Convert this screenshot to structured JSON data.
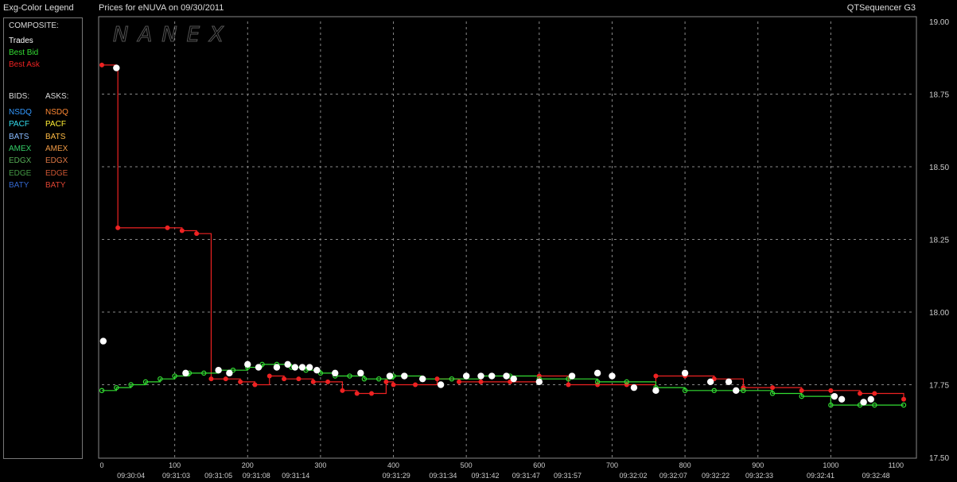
{
  "header": {
    "legend_title": "Exg-Color Legend",
    "chart_title": "Prices for  eNUVA  on  09/30/2011",
    "app_name": "QTSequencer G3"
  },
  "legend": {
    "composite_label": "COMPOSITE:",
    "composite": [
      {
        "label": "Trades",
        "color": "#ffffff"
      },
      {
        "label": "Best Bid",
        "color": "#33dd33"
      },
      {
        "label": "Best Ask",
        "color": "#ee2222"
      }
    ],
    "bids_label": "BIDS:",
    "asks_label": "ASKS:",
    "bids": [
      {
        "label": "NSDQ",
        "color": "#3399ff"
      },
      {
        "label": "PACF",
        "color": "#33ddee"
      },
      {
        "label": "BATS",
        "color": "#88bbff"
      },
      {
        "label": "AMEX",
        "color": "#33cc66"
      },
      {
        "label": "EDGX",
        "color": "#55aa55"
      },
      {
        "label": "EDGE",
        "color": "#449944"
      },
      {
        "label": "BATY",
        "color": "#3366cc"
      }
    ],
    "asks": [
      {
        "label": "NSDQ",
        "color": "#ff8833"
      },
      {
        "label": "PACF",
        "color": "#ffee33"
      },
      {
        "label": "BATS",
        "color": "#ffbb44"
      },
      {
        "label": "AMEX",
        "color": "#ee9944"
      },
      {
        "label": "EDGX",
        "color": "#dd7744"
      },
      {
        "label": "EDGE",
        "color": "#cc5533"
      },
      {
        "label": "BATY",
        "color": "#dd4433"
      }
    ]
  },
  "watermark": "NANEX",
  "chart_data": {
    "type": "line",
    "xlim": [
      0,
      1100
    ],
    "ylim": [
      17.5,
      19.0
    ],
    "x_ticks": [
      0,
      100,
      200,
      300,
      400,
      500,
      600,
      700,
      800,
      900,
      1000,
      1100
    ],
    "y_ticks": [
      17.5,
      17.75,
      18.0,
      18.25,
      18.5,
      18.75,
      19.0
    ],
    "y_tick_labels": [
      "17.50",
      "17.75",
      "18.00",
      "18.25",
      "18.50",
      "18.75",
      "19.00"
    ],
    "time_labels": [
      {
        "x": 40,
        "label": "09:30:04"
      },
      {
        "x": 102,
        "label": "09:31:03"
      },
      {
        "x": 160,
        "label": "09:31:05"
      },
      {
        "x": 212,
        "label": "09:31:08"
      },
      {
        "x": 266,
        "label": "09:31:14"
      },
      {
        "x": 404,
        "label": "09:31:29"
      },
      {
        "x": 468,
        "label": "09:31:34"
      },
      {
        "x": 526,
        "label": "09:31:42"
      },
      {
        "x": 582,
        "label": "09:31:47"
      },
      {
        "x": 639,
        "label": "09:31:57"
      },
      {
        "x": 729,
        "label": "09:32:02"
      },
      {
        "x": 784,
        "label": "09:32:07"
      },
      {
        "x": 842,
        "label": "09:32:22"
      },
      {
        "x": 902,
        "label": "09:32:33"
      },
      {
        "x": 986,
        "label": "09:32:41"
      },
      {
        "x": 1062,
        "label": "09:32:48"
      }
    ],
    "grid": true,
    "series": [
      {
        "name": "Best Ask",
        "color": "#ee2222",
        "marker": "dot",
        "x": [
          0,
          20,
          22,
          90,
          110,
          130,
          150,
          170,
          190,
          210,
          230,
          250,
          270,
          290,
          310,
          330,
          350,
          370,
          390,
          400,
          430,
          460,
          490,
          520,
          560,
          600,
          640,
          680,
          720,
          760,
          800,
          840,
          880,
          920,
          960,
          1000,
          1040,
          1060,
          1100
        ],
        "y": [
          18.85,
          18.84,
          18.29,
          18.29,
          18.28,
          18.27,
          17.77,
          17.77,
          17.76,
          17.75,
          17.78,
          17.77,
          17.77,
          17.76,
          17.76,
          17.73,
          17.72,
          17.72,
          17.76,
          17.75,
          17.75,
          17.77,
          17.76,
          17.76,
          17.76,
          17.78,
          17.75,
          17.75,
          17.75,
          17.78,
          17.78,
          17.77,
          17.74,
          17.74,
          17.73,
          17.73,
          17.72,
          17.72,
          17.7
        ]
      },
      {
        "name": "Best Bid",
        "color": "#33dd33",
        "marker": "ring",
        "x": [
          0,
          20,
          40,
          60,
          80,
          100,
          120,
          140,
          160,
          180,
          200,
          220,
          240,
          260,
          280,
          300,
          320,
          340,
          360,
          380,
          400,
          440,
          480,
          520,
          560,
          600,
          640,
          680,
          720,
          760,
          800,
          840,
          880,
          920,
          960,
          1000,
          1040,
          1060,
          1100
        ],
        "y": [
          17.73,
          17.74,
          17.75,
          17.76,
          17.77,
          17.78,
          17.79,
          17.79,
          17.8,
          17.8,
          17.81,
          17.82,
          17.82,
          17.81,
          17.8,
          17.79,
          17.78,
          17.78,
          17.77,
          17.77,
          17.78,
          17.77,
          17.77,
          17.78,
          17.78,
          17.77,
          17.77,
          17.76,
          17.76,
          17.74,
          17.73,
          17.73,
          17.73,
          17.72,
          17.71,
          17.68,
          17.68,
          17.68,
          17.68
        ]
      },
      {
        "name": "Trades",
        "color": "#ffffff",
        "marker": "dot",
        "x": [
          2,
          20,
          115,
          160,
          175,
          200,
          215,
          240,
          255,
          265,
          275,
          285,
          295,
          320,
          355,
          395,
          415,
          440,
          465,
          500,
          520,
          535,
          555,
          565,
          600,
          645,
          680,
          700,
          730,
          760,
          800,
          835,
          860,
          870,
          1005,
          1015,
          1045,
          1055
        ],
        "y": [
          17.9,
          18.84,
          17.79,
          17.8,
          17.79,
          17.82,
          17.81,
          17.81,
          17.82,
          17.81,
          17.81,
          17.81,
          17.8,
          17.79,
          17.79,
          17.78,
          17.78,
          17.77,
          17.75,
          17.78,
          17.78,
          17.78,
          17.78,
          17.77,
          17.76,
          17.78,
          17.79,
          17.78,
          17.74,
          17.73,
          17.79,
          17.76,
          17.76,
          17.73,
          17.71,
          17.7,
          17.69,
          17.7
        ]
      }
    ]
  }
}
